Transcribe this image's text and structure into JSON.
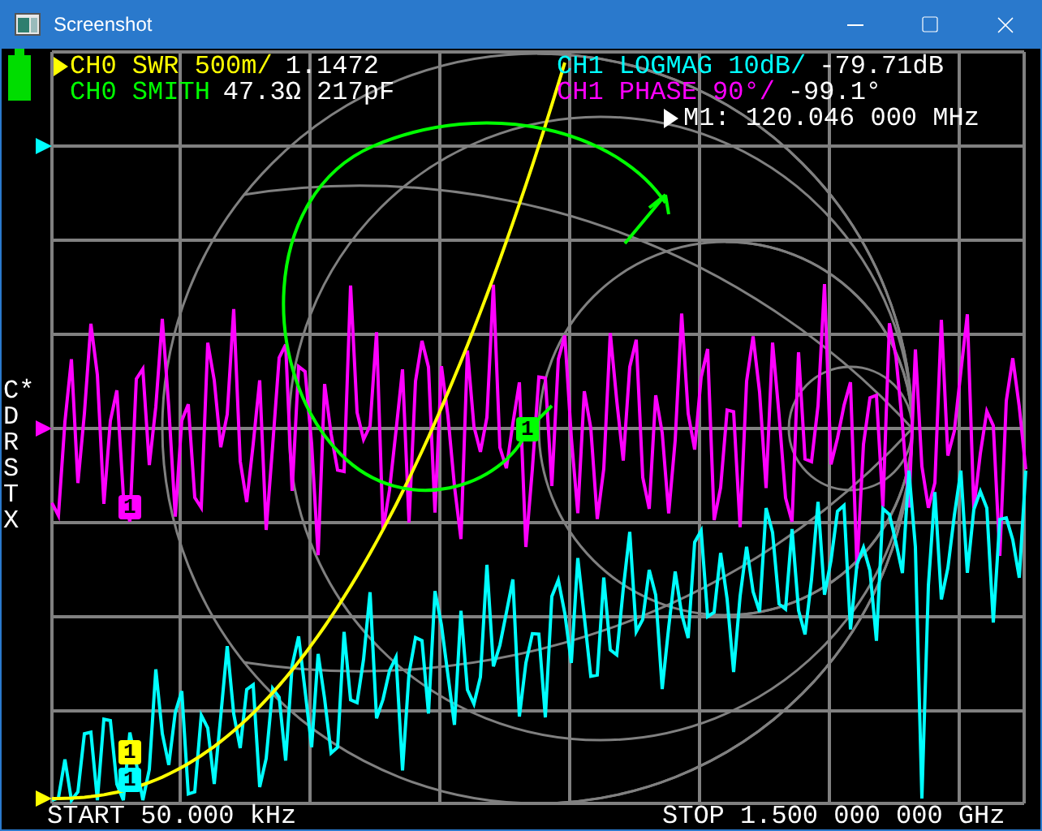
{
  "window": {
    "title": "Screenshot"
  },
  "traces": [
    {
      "label": "CH0 SWR 500m/",
      "value": "1.1472",
      "color": "#ffff00",
      "selected": true
    },
    {
      "label": "CH0 SMITH",
      "value": "47.3Ω 217pF",
      "color": "#00ff00",
      "selected": false
    },
    {
      "label": "CH1 LOGMAG 10dB/",
      "value": "-79.71dB",
      "color": "#00ffff",
      "selected": false
    },
    {
      "label": "CH1 PHASE 90°/",
      "value": "-99.1°",
      "color": "#ff00ff",
      "selected": false
    }
  ],
  "marker_readout": {
    "text": "M1: 120.046 000 MHz",
    "selected": true
  },
  "cal_status": [
    "C*",
    "D",
    "R",
    "S",
    "T",
    "X"
  ],
  "markers": [
    {
      "label": "1",
      "color": "#00ff00"
    },
    {
      "label": "1",
      "color": "#ff00ff"
    },
    {
      "label": "1",
      "color": "#ffff00"
    },
    {
      "label": "1",
      "color": "#00ffff"
    }
  ],
  "start": "START 50.000 kHz",
  "stop": "STOP 1.500 000 000 GHz"
}
